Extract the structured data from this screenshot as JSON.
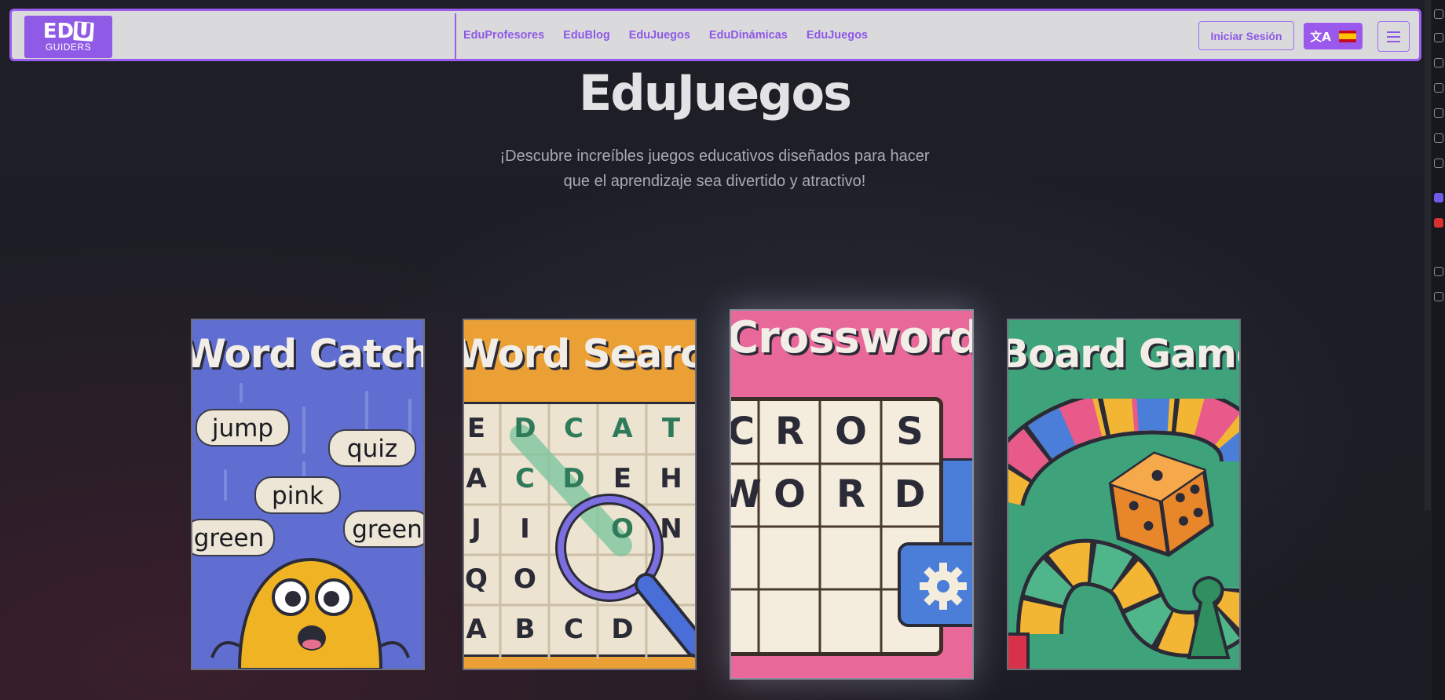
{
  "header": {
    "logo_line1": "EDU",
    "logo_line2": "GUIDERS",
    "nav": [
      "EduProfesores",
      "EduBlog",
      "EduJuegos",
      "EduDinámicas",
      "EduJuegos"
    ],
    "login_label": "Iniciar Sesión",
    "translate_icon": "translate-icon",
    "flag_icon": "spain-flag-icon",
    "menu_icon": "hamburger-menu-icon"
  },
  "hero": {
    "title": "EduJuegos",
    "subtitle_line1": "¡Descubre increíbles juegos educativos diseñados para hacer",
    "subtitle_line2": "que el aprendizaje sea divertido y atractivo!"
  },
  "games": [
    {
      "title": "Word Catcher",
      "color": "#5f6ed0",
      "words": [
        "jump",
        "quiz",
        "pink",
        "green",
        "green"
      ]
    },
    {
      "title": "Word Search",
      "color": "#eaa035",
      "grid": [
        [
          "E",
          "D",
          "C",
          "A",
          "T"
        ],
        [
          "A",
          "C",
          "D",
          "E",
          "H"
        ],
        [
          "J",
          "I",
          "",
          "O",
          "N"
        ],
        [
          "Q",
          "O",
          "",
          "",
          ""
        ],
        [
          "A",
          "B",
          "C",
          "D",
          ""
        ]
      ]
    },
    {
      "title": "Crossword",
      "color": "#e8689a",
      "rows": [
        [
          "C",
          "R",
          "O",
          "S"
        ],
        [
          "W",
          "O",
          "R",
          "D"
        ]
      ]
    },
    {
      "title": "Board Game",
      "color": "#3ea37a"
    }
  ],
  "colors": {
    "accent": "#9b5cf0",
    "navbar_bg": "#dadadc"
  }
}
